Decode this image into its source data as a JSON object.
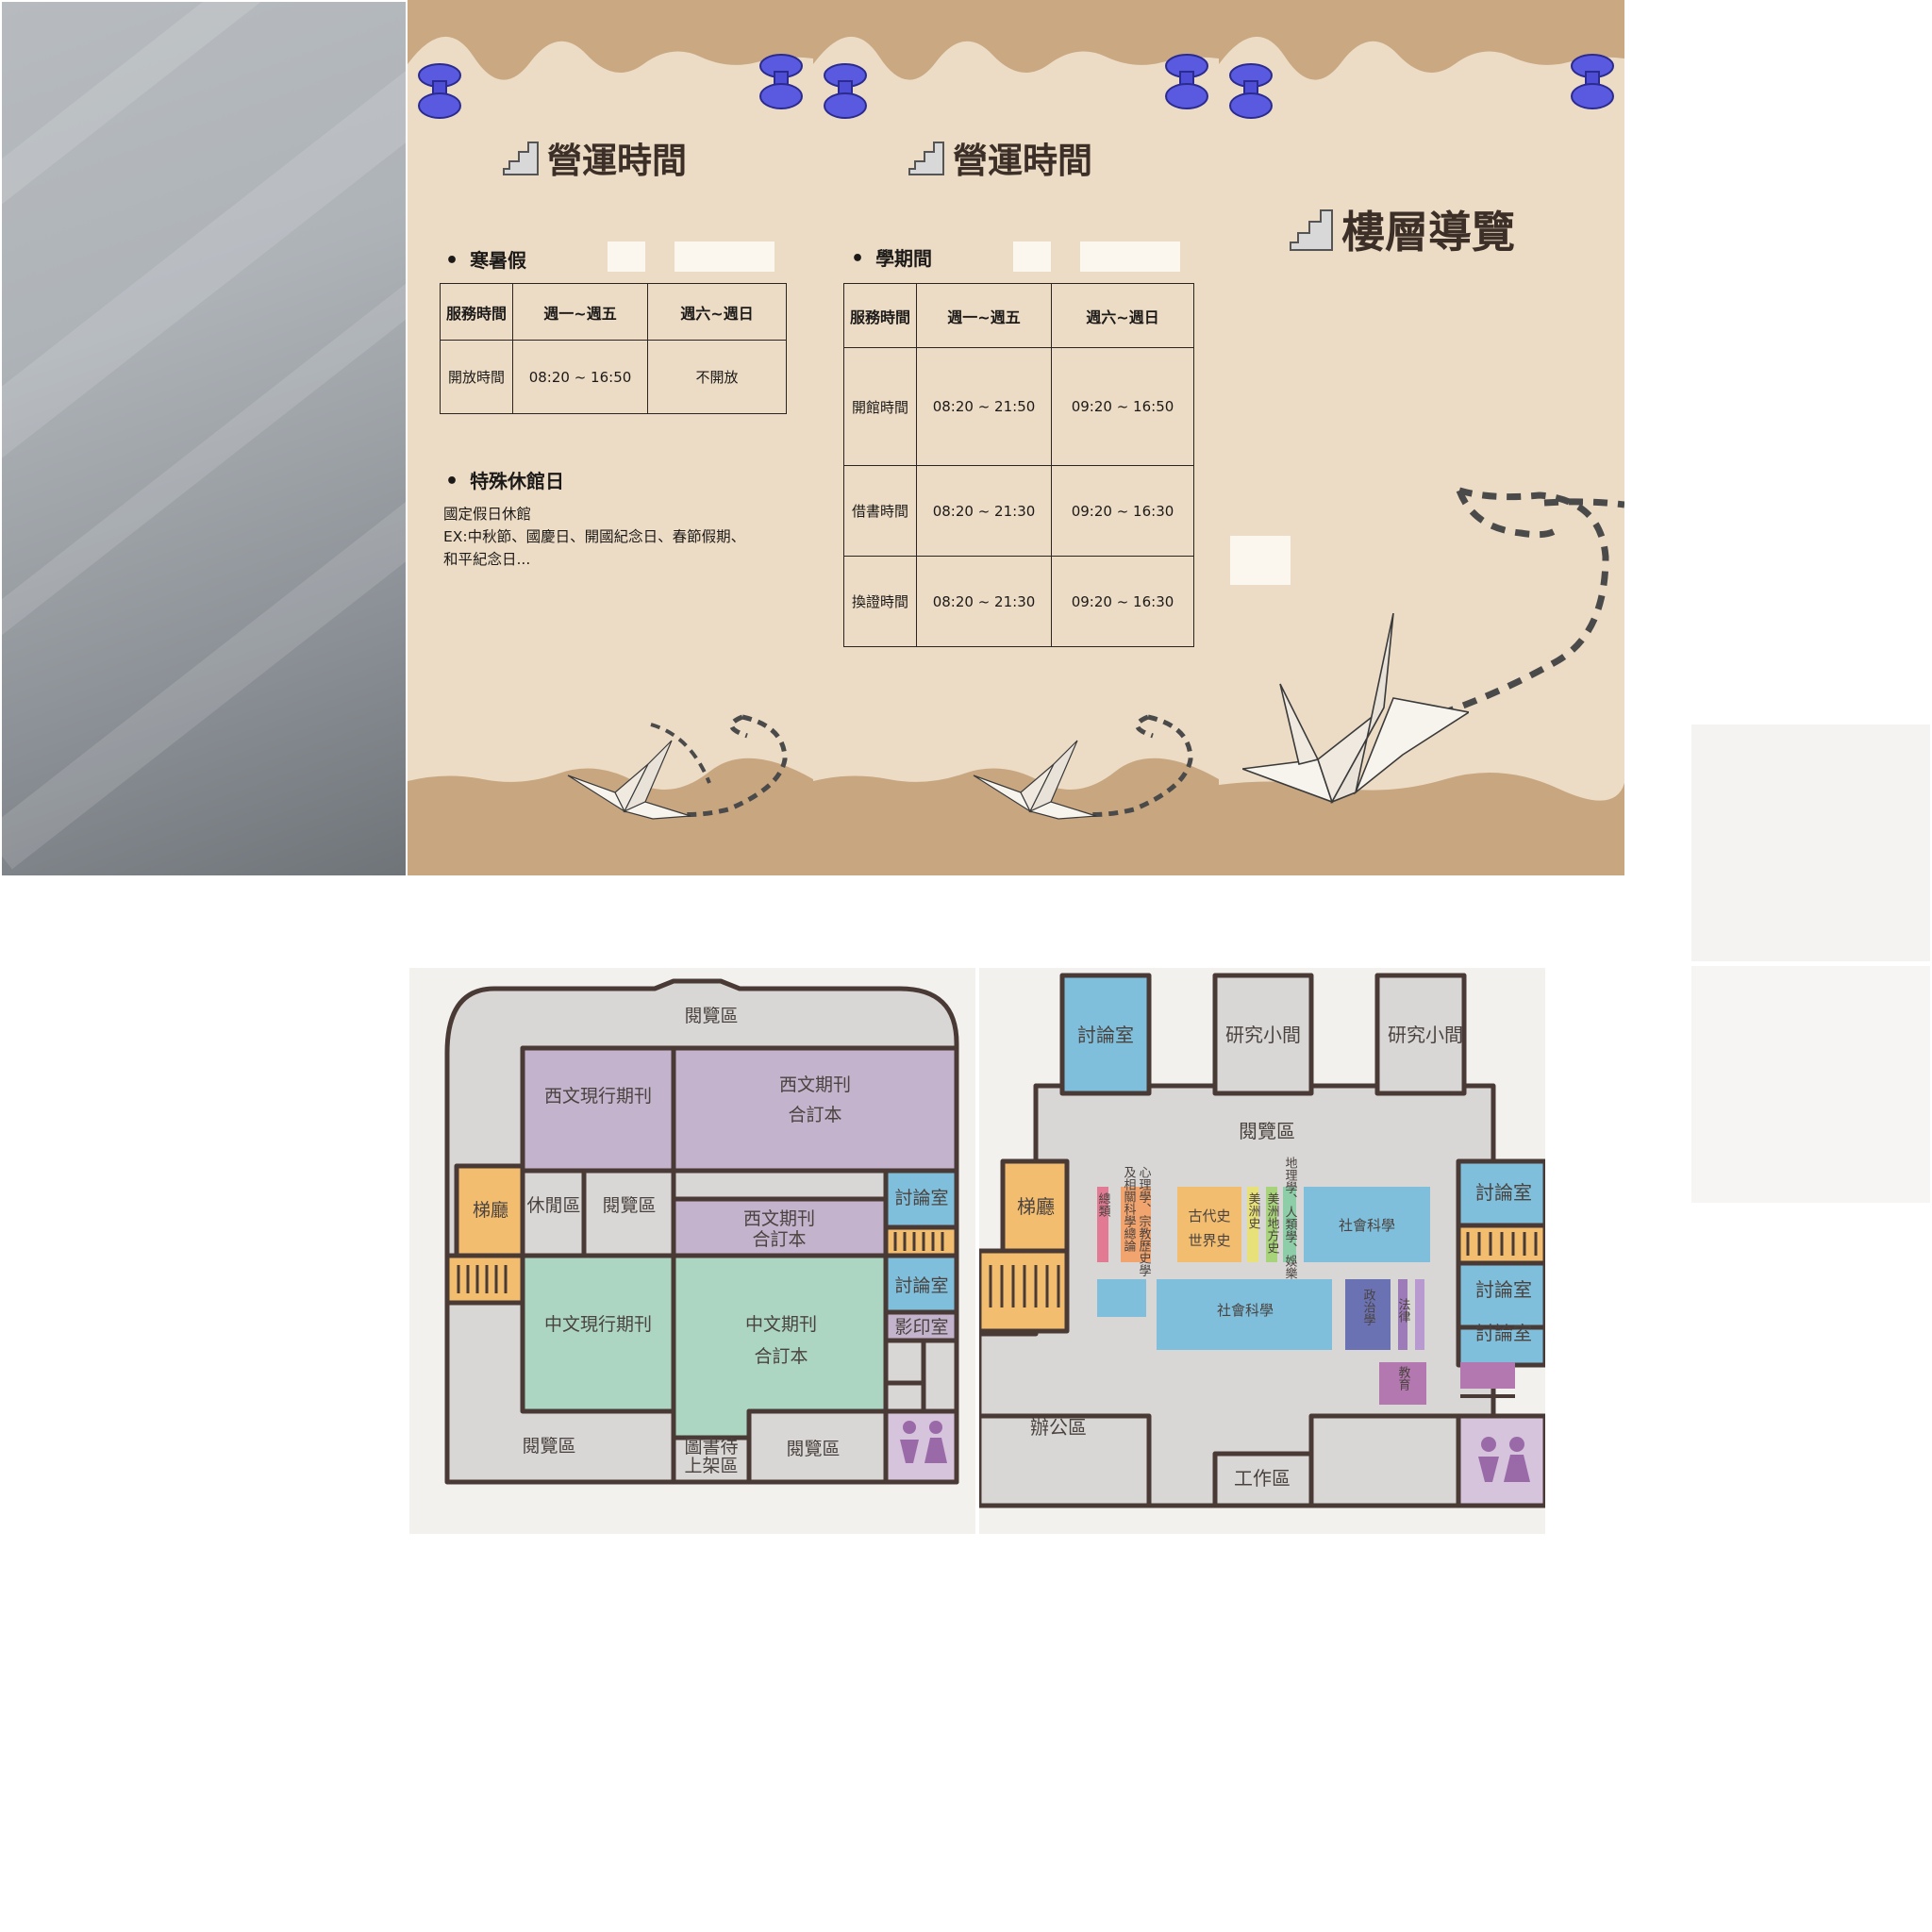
{
  "panel1": {
    "heading": "營運時間",
    "section1_title": "寒暑假",
    "table_headers": [
      "服務時間",
      "週一~週五",
      "週六~週日"
    ],
    "table_rows": [
      {
        "label": "開放時間",
        "weekday": "08:20 ~ 16:50",
        "weekend": "不開放"
      }
    ],
    "section2_title": "特殊休館日",
    "closure_lines": [
      "國定假日休館",
      "EX:中秋節、國慶日、開國紀念日、春節假期、",
      "和平紀念日..."
    ]
  },
  "panel2": {
    "heading": "營運時間",
    "section_title": "學期間",
    "table_headers": [
      "服務時間",
      "週一~週五",
      "週六~週日"
    ],
    "table_rows": [
      {
        "label": "開館時間",
        "weekday": "08:20 ~ 21:50",
        "weekend": "09:20 ~ 16:50"
      },
      {
        "label": "借書時間",
        "weekday": "08:20 ~ 21:30",
        "weekend": "09:20 ~ 16:30"
      },
      {
        "label": "換證時間",
        "weekday": "08:20 ~ 21:30",
        "weekend": "09:20 ~ 16:30"
      }
    ]
  },
  "panel3": {
    "heading": "樓層導覽"
  },
  "floor_plan_a": {
    "labels": {
      "reading_top": "閱覽區",
      "west_current": "西文現行期刊",
      "west_bound_a": "西文期刊",
      "west_bound_b": "合訂本",
      "elevator": "梯廳",
      "lounge": "休閒區",
      "reading_mid": "閱覽區",
      "west_bound2_a": "西文期刊",
      "west_bound2_b": "合訂本",
      "discussion1": "討論室",
      "discussion2": "討論室",
      "copy": "影印室",
      "cn_current": "中文現行期刊",
      "cn_bound_a": "中文期刊",
      "cn_bound_b": "合訂本",
      "reading_bl": "閱覽區",
      "shelving_a": "圖書待",
      "shelving_b": "上架區",
      "reading_br": "閱覽區"
    }
  },
  "floor_plan_b": {
    "labels": {
      "discussion_top": "討論室",
      "study1": "研究小間",
      "study2": "研究小間",
      "reading": "閱覽區",
      "elevator": "梯廳",
      "general": "總類",
      "psych": "心理學、宗教歷史學",
      "related": "及相關科學總論",
      "ancient": "古代史",
      "world": "世界史",
      "america": "美洲史",
      "america_local": "美洲地方史",
      "geo": "地理學、人類學、娛樂",
      "social1": "社會科學",
      "social2": "社會科學",
      "politics": "政治學",
      "law": "法律",
      "education": "教育",
      "disc_r1": "討論室",
      "disc_r2": "討論室",
      "disc_r3": "討論室",
      "office": "辦公區",
      "work": "工作區"
    }
  },
  "colors": {
    "paper": "#ecdcc5",
    "kraft": "#c9a882",
    "pin": "#5a5ae0",
    "purple": "#c4b3cc",
    "green": "#acd5c2",
    "blue": "#7fbfdc",
    "orange": "#f3bd6f",
    "grey": "#d9d7d5"
  }
}
